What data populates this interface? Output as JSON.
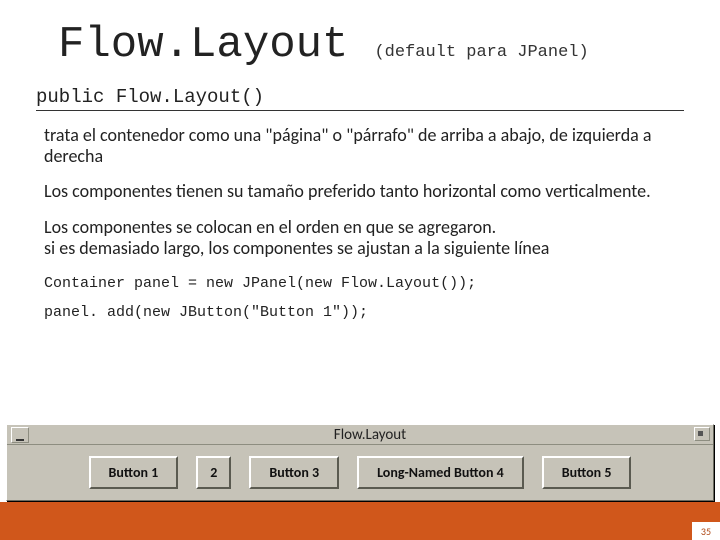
{
  "title": "Flow.Layout",
  "title_note": "(default para JPanel)",
  "constructor": "public Flow.Layout()",
  "paragraphs": {
    "p1": "trata el contenedor como una \"página\" o \"párrafo\" de arriba a abajo, de izquierda a derecha",
    "p2": "Los componentes tienen su tamaño preferido tanto horizontal como verticalmente.",
    "p3": "Los componentes se colocan en el orden en que se agregaron.\nsi es demasiado largo, los componentes se ajustan a la siguiente línea"
  },
  "code": {
    "l1": "Container panel = new JPanel(new Flow.Layout());",
    "l2": "panel. add(new JButton(\"Button 1\"));"
  },
  "window": {
    "title": "Flow.Layout",
    "buttons": [
      "Button 1",
      "2",
      "Button 3",
      "Long-Named Button 4",
      "Button 5"
    ]
  },
  "page_number": "35"
}
